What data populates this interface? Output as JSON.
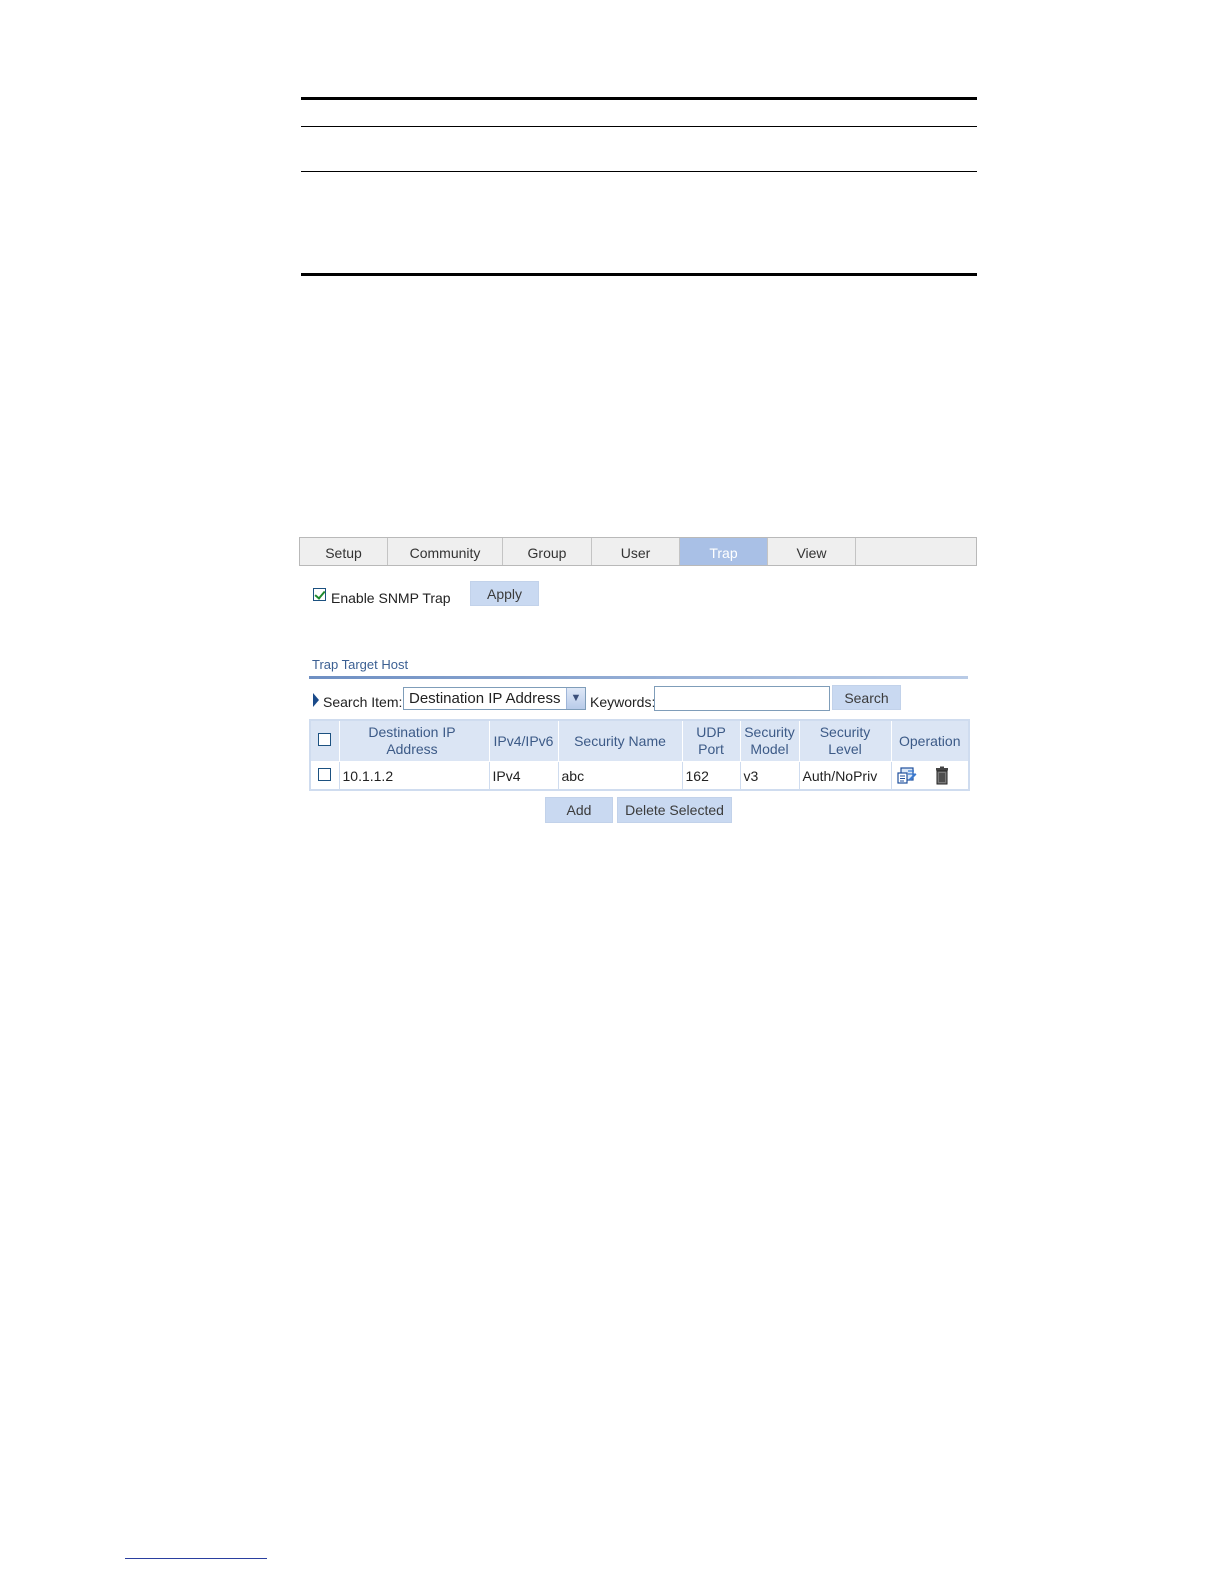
{
  "tabs": [
    {
      "label": "Setup",
      "active": false
    },
    {
      "label": "Community",
      "active": false
    },
    {
      "label": "Group",
      "active": false
    },
    {
      "label": "User",
      "active": false
    },
    {
      "label": "Trap",
      "active": true
    },
    {
      "label": "View",
      "active": false
    }
  ],
  "enable_trap": {
    "label": "Enable SNMP Trap",
    "checked": true
  },
  "apply_label": "Apply",
  "section_title": "Trap Target Host",
  "search": {
    "item_label": "Search Item:",
    "selected": "Destination IP Address",
    "keywords_label": "Keywords:",
    "keywords_value": "",
    "button_label": "Search"
  },
  "table": {
    "headers": {
      "dest_ip": "Destination IP Address",
      "ipver": "IPv4/IPv6",
      "secname": "Security Name",
      "udp": "UDP Port",
      "secmodel": "Security Model",
      "seclevel": "Security Level",
      "operation": "Operation"
    },
    "rows": [
      {
        "dest_ip": "10.1.1.2",
        "ipver": "IPv4",
        "secname": "abc",
        "udp": "162",
        "secmodel": "v3",
        "seclevel": "Auth/NoPriv"
      }
    ]
  },
  "buttons": {
    "add": "Add",
    "delete_selected": "Delete Selected"
  },
  "colors": {
    "active_tab": "#a9c0e6",
    "header_bg": "#dbe5f4",
    "button_bg": "#c9d9f1",
    "title_text": "#3b5f92"
  },
  "icons": {
    "edit": "edit-icon",
    "delete": "trash-icon",
    "search_item": "triangle-right-icon"
  }
}
